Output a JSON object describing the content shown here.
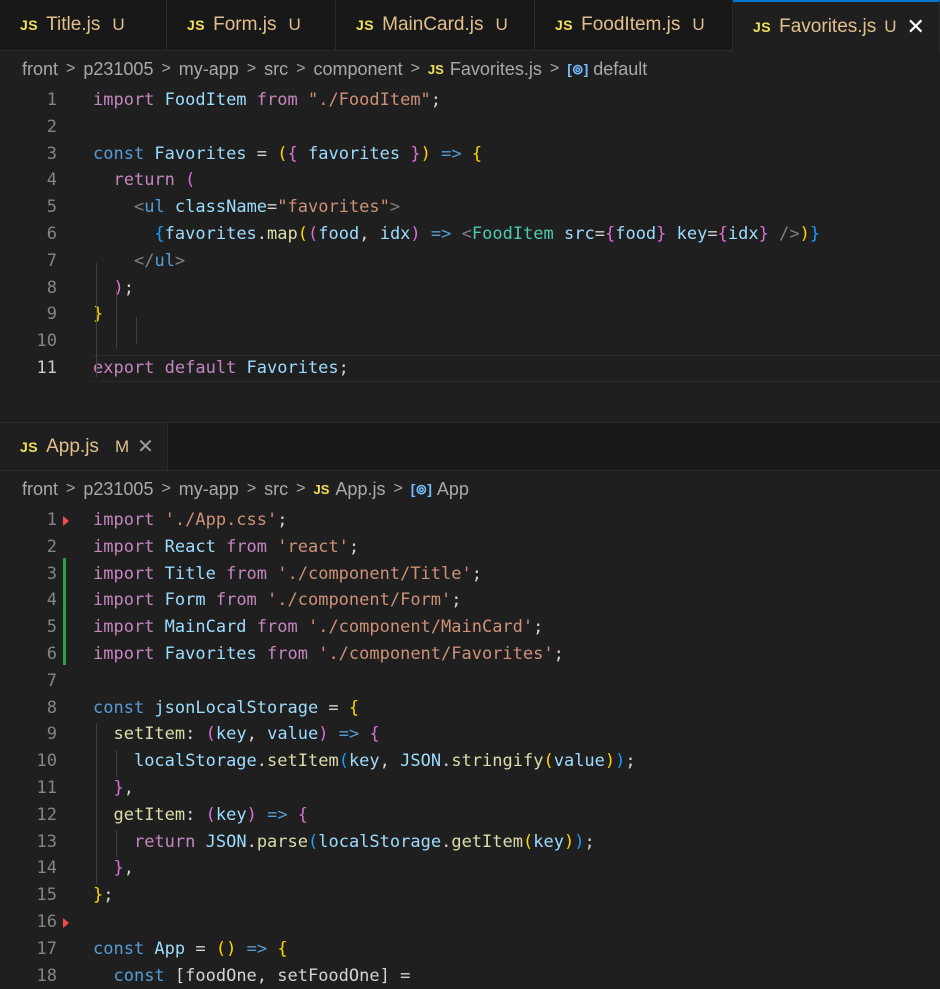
{
  "top_group": {
    "tabs": [
      {
        "label": "Title.js",
        "status": "U"
      },
      {
        "label": "Form.js",
        "status": "U"
      },
      {
        "label": "MainCard.js",
        "status": "U"
      },
      {
        "label": "FoodItem.js",
        "status": "U"
      },
      {
        "label": "Favorites.js",
        "status": "U",
        "close": "✕"
      }
    ],
    "breadcrumb": {
      "parts": [
        "front",
        "p231005",
        "my-app",
        "src",
        "component"
      ],
      "file": "Favorites.js",
      "symbol": "default"
    },
    "current_line": 11,
    "lines": [
      [
        [
          "ctl",
          "import "
        ],
        [
          "var",
          "FoodItem"
        ],
        [
          "ctl",
          " from "
        ],
        [
          "str",
          "\"./FoodItem\""
        ],
        [
          "plain",
          ";"
        ]
      ],
      [],
      [
        [
          "kw",
          "const "
        ],
        [
          "var",
          "Favorites"
        ],
        [
          "plain",
          " = "
        ],
        [
          "br1",
          "("
        ],
        [
          "br2",
          "{"
        ],
        [
          "var",
          " favorites "
        ],
        [
          "br2",
          "}"
        ],
        [
          "br1",
          ")"
        ],
        [
          "kw",
          " => "
        ],
        [
          "br1",
          "{"
        ]
      ],
      [
        [
          "plain",
          "  "
        ],
        [
          "ctl",
          "return "
        ],
        [
          "br2",
          "("
        ]
      ],
      [
        [
          "plain",
          "    "
        ],
        [
          "gray",
          "<"
        ],
        [
          "tag",
          "ul"
        ],
        [
          "attr",
          " className"
        ],
        [
          "plain",
          "="
        ],
        [
          "str",
          "\"favorites\""
        ],
        [
          "gray",
          ">"
        ]
      ],
      [
        [
          "plain",
          "      "
        ],
        [
          "br3",
          "{"
        ],
        [
          "var",
          "favorites"
        ],
        [
          "plain",
          "."
        ],
        [
          "fn",
          "map"
        ],
        [
          "br1",
          "("
        ],
        [
          "br2",
          "("
        ],
        [
          "var",
          "food"
        ],
        [
          "plain",
          ", "
        ],
        [
          "var",
          "idx"
        ],
        [
          "br2",
          ")"
        ],
        [
          "kw",
          " => "
        ],
        [
          "gray",
          "<"
        ],
        [
          "comp",
          "FoodItem"
        ],
        [
          "attr",
          " src"
        ],
        [
          "plain",
          "="
        ],
        [
          "br2",
          "{"
        ],
        [
          "var",
          "food"
        ],
        [
          "br2",
          "}"
        ],
        [
          "attr",
          " key"
        ],
        [
          "plain",
          "="
        ],
        [
          "br2",
          "{"
        ],
        [
          "var",
          "idx"
        ],
        [
          "br2",
          "}"
        ],
        [
          "gray",
          " />"
        ],
        [
          "br1",
          ")"
        ],
        [
          "br3",
          "}"
        ]
      ],
      [
        [
          "plain",
          "    "
        ],
        [
          "gray",
          "</"
        ],
        [
          "tag",
          "ul"
        ],
        [
          "gray",
          ">"
        ]
      ],
      [
        [
          "plain",
          "  "
        ],
        [
          "br2",
          ")"
        ],
        [
          "plain",
          ";"
        ]
      ],
      [
        [
          "br1",
          "}"
        ]
      ],
      [],
      [
        [
          "ctl",
          "export default "
        ],
        [
          "var",
          "Favorites"
        ],
        [
          "plain",
          ";"
        ]
      ]
    ]
  },
  "bottom_group": {
    "tabs": [
      {
        "label": "App.js",
        "status": "M",
        "close": "✕"
      }
    ],
    "breadcrumb": {
      "parts": [
        "front",
        "p231005",
        "my-app",
        "src"
      ],
      "file": "App.js",
      "symbol": "App"
    },
    "lines": [
      [
        [
          "ctl",
          "import "
        ],
        [
          "str",
          "'./App.css'"
        ],
        [
          "plain",
          ";"
        ]
      ],
      [
        [
          "ctl",
          "import "
        ],
        [
          "var",
          "React"
        ],
        [
          "ctl",
          " from "
        ],
        [
          "str",
          "'react'"
        ],
        [
          "plain",
          ";"
        ]
      ],
      [
        [
          "ctl",
          "import "
        ],
        [
          "var",
          "Title"
        ],
        [
          "ctl",
          " from "
        ],
        [
          "str",
          "'./component/Title'"
        ],
        [
          "plain",
          ";"
        ]
      ],
      [
        [
          "ctl",
          "import "
        ],
        [
          "var",
          "Form"
        ],
        [
          "ctl",
          " from "
        ],
        [
          "str",
          "'./component/Form'"
        ],
        [
          "plain",
          ";"
        ]
      ],
      [
        [
          "ctl",
          "import "
        ],
        [
          "var",
          "MainCard"
        ],
        [
          "ctl",
          " from "
        ],
        [
          "str",
          "'./component/MainCard'"
        ],
        [
          "plain",
          ";"
        ]
      ],
      [
        [
          "ctl",
          "import "
        ],
        [
          "var",
          "Favorites"
        ],
        [
          "ctl",
          " from "
        ],
        [
          "str",
          "'./component/Favorites'"
        ],
        [
          "plain",
          ";"
        ]
      ],
      [],
      [
        [
          "kw",
          "const "
        ],
        [
          "var",
          "jsonLocalStorage"
        ],
        [
          "plain",
          " = "
        ],
        [
          "br1",
          "{"
        ]
      ],
      [
        [
          "plain",
          "  "
        ],
        [
          "fn",
          "setItem"
        ],
        [
          "plain",
          ": "
        ],
        [
          "br2",
          "("
        ],
        [
          "var",
          "key"
        ],
        [
          "plain",
          ", "
        ],
        [
          "var",
          "value"
        ],
        [
          "br2",
          ")"
        ],
        [
          "kw",
          " => "
        ],
        [
          "br2",
          "{"
        ]
      ],
      [
        [
          "plain",
          "    "
        ],
        [
          "var",
          "localStorage"
        ],
        [
          "plain",
          "."
        ],
        [
          "fn",
          "setItem"
        ],
        [
          "br3",
          "("
        ],
        [
          "var",
          "key"
        ],
        [
          "plain",
          ", "
        ],
        [
          "var",
          "JSON"
        ],
        [
          "plain",
          "."
        ],
        [
          "fn",
          "stringify"
        ],
        [
          "br1",
          "("
        ],
        [
          "var",
          "value"
        ],
        [
          "br1",
          ")"
        ],
        [
          "br3",
          ")"
        ],
        [
          "plain",
          ";"
        ]
      ],
      [
        [
          "plain",
          "  "
        ],
        [
          "br2",
          "}"
        ],
        [
          "plain",
          ","
        ]
      ],
      [
        [
          "plain",
          "  "
        ],
        [
          "fn",
          "getItem"
        ],
        [
          "plain",
          ": "
        ],
        [
          "br2",
          "("
        ],
        [
          "var",
          "key"
        ],
        [
          "br2",
          ")"
        ],
        [
          "kw",
          " => "
        ],
        [
          "br2",
          "{"
        ]
      ],
      [
        [
          "plain",
          "    "
        ],
        [
          "ctl",
          "return "
        ],
        [
          "var",
          "JSON"
        ],
        [
          "plain",
          "."
        ],
        [
          "fn",
          "parse"
        ],
        [
          "br3",
          "("
        ],
        [
          "var",
          "localStorage"
        ],
        [
          "plain",
          "."
        ],
        [
          "fn",
          "getItem"
        ],
        [
          "br1",
          "("
        ],
        [
          "var",
          "key"
        ],
        [
          "br1",
          ")"
        ],
        [
          "br3",
          ")"
        ],
        [
          "plain",
          ";"
        ]
      ],
      [
        [
          "plain",
          "  "
        ],
        [
          "br2",
          "}"
        ],
        [
          "plain",
          ","
        ]
      ],
      [
        [
          "br1",
          "}"
        ],
        [
          "plain",
          ";"
        ]
      ],
      [],
      [
        [
          "kw",
          "const "
        ],
        [
          "var",
          "App"
        ],
        [
          "plain",
          " = "
        ],
        [
          "br1",
          "("
        ],
        [
          "br1",
          ")"
        ],
        [
          "kw",
          " => "
        ],
        [
          "br1",
          "{"
        ]
      ],
      [
        [
          "plain",
          "  "
        ],
        [
          "kw",
          "const "
        ],
        [
          "plain",
          "[foodOne, setFoodOne] = "
        ]
      ]
    ]
  }
}
